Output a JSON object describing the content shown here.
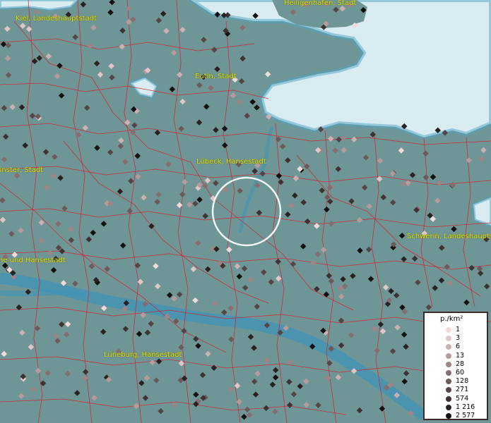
{
  "map": {
    "colors": {
      "land": "#6f9696",
      "sea": "#d9ecf2",
      "river": "#3f93b8",
      "border": "#d81d2a",
      "label": "#e7e600",
      "highlight": "#ffffff"
    },
    "cities": [
      {
        "id": "kiel",
        "label": "Kiel, Landeshauptstadt"
      },
      {
        "id": "heiligenhafen",
        "label": "Heiligenhafen, Stadt"
      },
      {
        "id": "eutin",
        "label": "Eutin, Stadt"
      },
      {
        "id": "luebeck",
        "label": "Lübeck, Hansestadt"
      },
      {
        "id": "neumuenster",
        "label": "ünster, Stadt"
      },
      {
        "id": "hamburg",
        "label": "he und Hansestadt"
      },
      {
        "id": "schwerin",
        "label": "Schwerin, Landeshauptstadt"
      },
      {
        "id": "lueneburg",
        "label": "Lüneburg, Hansestadt"
      }
    ],
    "legend": {
      "title": "p./km²",
      "entries": [
        {
          "label": "1",
          "color": "#f2dada"
        },
        {
          "label": "3",
          "color": "#e2c6c7"
        },
        {
          "label": "6",
          "color": "#cdb0b2"
        },
        {
          "label": "13",
          "color": "#b79a9c"
        },
        {
          "label": "28",
          "color": "#9f8486"
        },
        {
          "label": "60",
          "color": "#866e70"
        },
        {
          "label": "128",
          "color": "#6e5a5b"
        },
        {
          "label": "271",
          "color": "#564546"
        },
        {
          "label": "574",
          "color": "#3e3232"
        },
        {
          "label": "1 216",
          "color": "#2a2222"
        },
        {
          "label": "2 577",
          "color": "#141010"
        }
      ]
    }
  }
}
